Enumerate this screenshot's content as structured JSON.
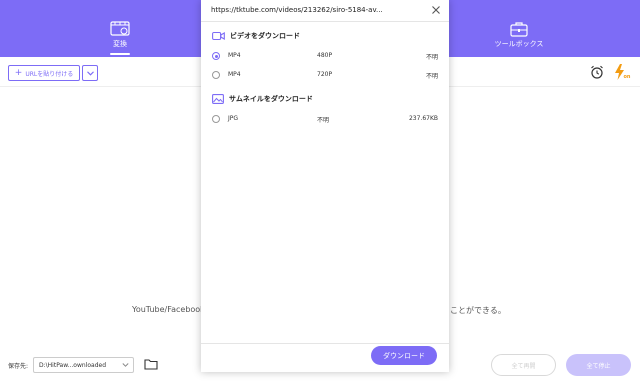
{
  "nav": {
    "convert_label": "変換",
    "toolbox_label": "ツールボックス"
  },
  "toolbar": {
    "add_url_label": "URLを貼り付ける"
  },
  "background_text": {
    "desc_left": "YouTube/Facebook/",
    "desc_right": "ることができる。"
  },
  "bottom": {
    "save_label": "保存先:",
    "save_path": "D:\\HitPaw...ownloaded",
    "resume_all_label": "全て再開",
    "stop_all_label": "全て停止"
  },
  "dialog": {
    "url": "https://tktube.com/videos/213262/siro-5184-av...",
    "video_section_title": "ビデオをダウンロード",
    "thumbnail_section_title": "サムネイルをダウンロード",
    "video_options": [
      {
        "format": "MP4",
        "resolution": "480P",
        "size": "不明",
        "selected": true
      },
      {
        "format": "MP4",
        "resolution": "720P",
        "size": "不明",
        "selected": false
      }
    ],
    "thumbnail_options": [
      {
        "format": "JPG",
        "resolution": "不明",
        "size": "237.67KB",
        "selected": false
      }
    ],
    "download_label": "ダウンロード"
  },
  "colors": {
    "accent": "#7d6cf6",
    "accent_disabled": "#c9c2fb",
    "boost_orange": "#f39c12"
  }
}
